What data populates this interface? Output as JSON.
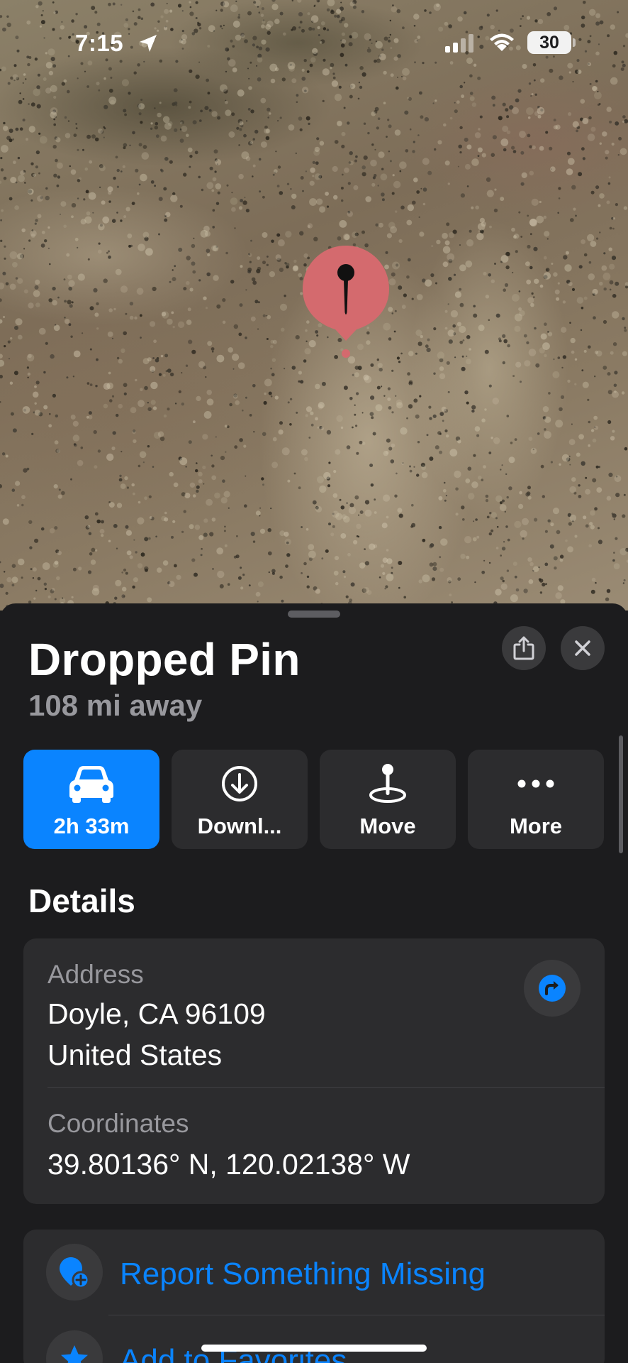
{
  "status_bar": {
    "time": "7:15",
    "battery": "30"
  },
  "colors": {
    "accent": "#0a84ff",
    "sheet_bg": "#1c1c1e",
    "card_bg": "#2c2c2e",
    "pin": "#d46a6e"
  },
  "map": {
    "type": "satellite",
    "marker": "pin-icon"
  },
  "sheet": {
    "title": "Dropped Pin",
    "subtitle": "108 mi away",
    "actions": [
      {
        "label": "2h 33m",
        "icon": "car-icon",
        "primary": true
      },
      {
        "label": "Downl...",
        "icon": "download-icon",
        "primary": false
      },
      {
        "label": "Move",
        "icon": "move-pin-icon",
        "primary": false
      },
      {
        "label": "More",
        "icon": "more-icon",
        "primary": false
      }
    ],
    "details_heading": "Details",
    "details": {
      "address_label": "Address",
      "address_line1": "Doyle, CA  96109",
      "address_line2": "United States",
      "coordinates_label": "Coordinates",
      "coordinates": "39.80136° N, 120.02138° W"
    },
    "list": [
      {
        "label": "Report Something Missing",
        "icon": "report-pin-icon"
      },
      {
        "label": "Add to Favorites",
        "icon": "star-icon"
      }
    ]
  }
}
